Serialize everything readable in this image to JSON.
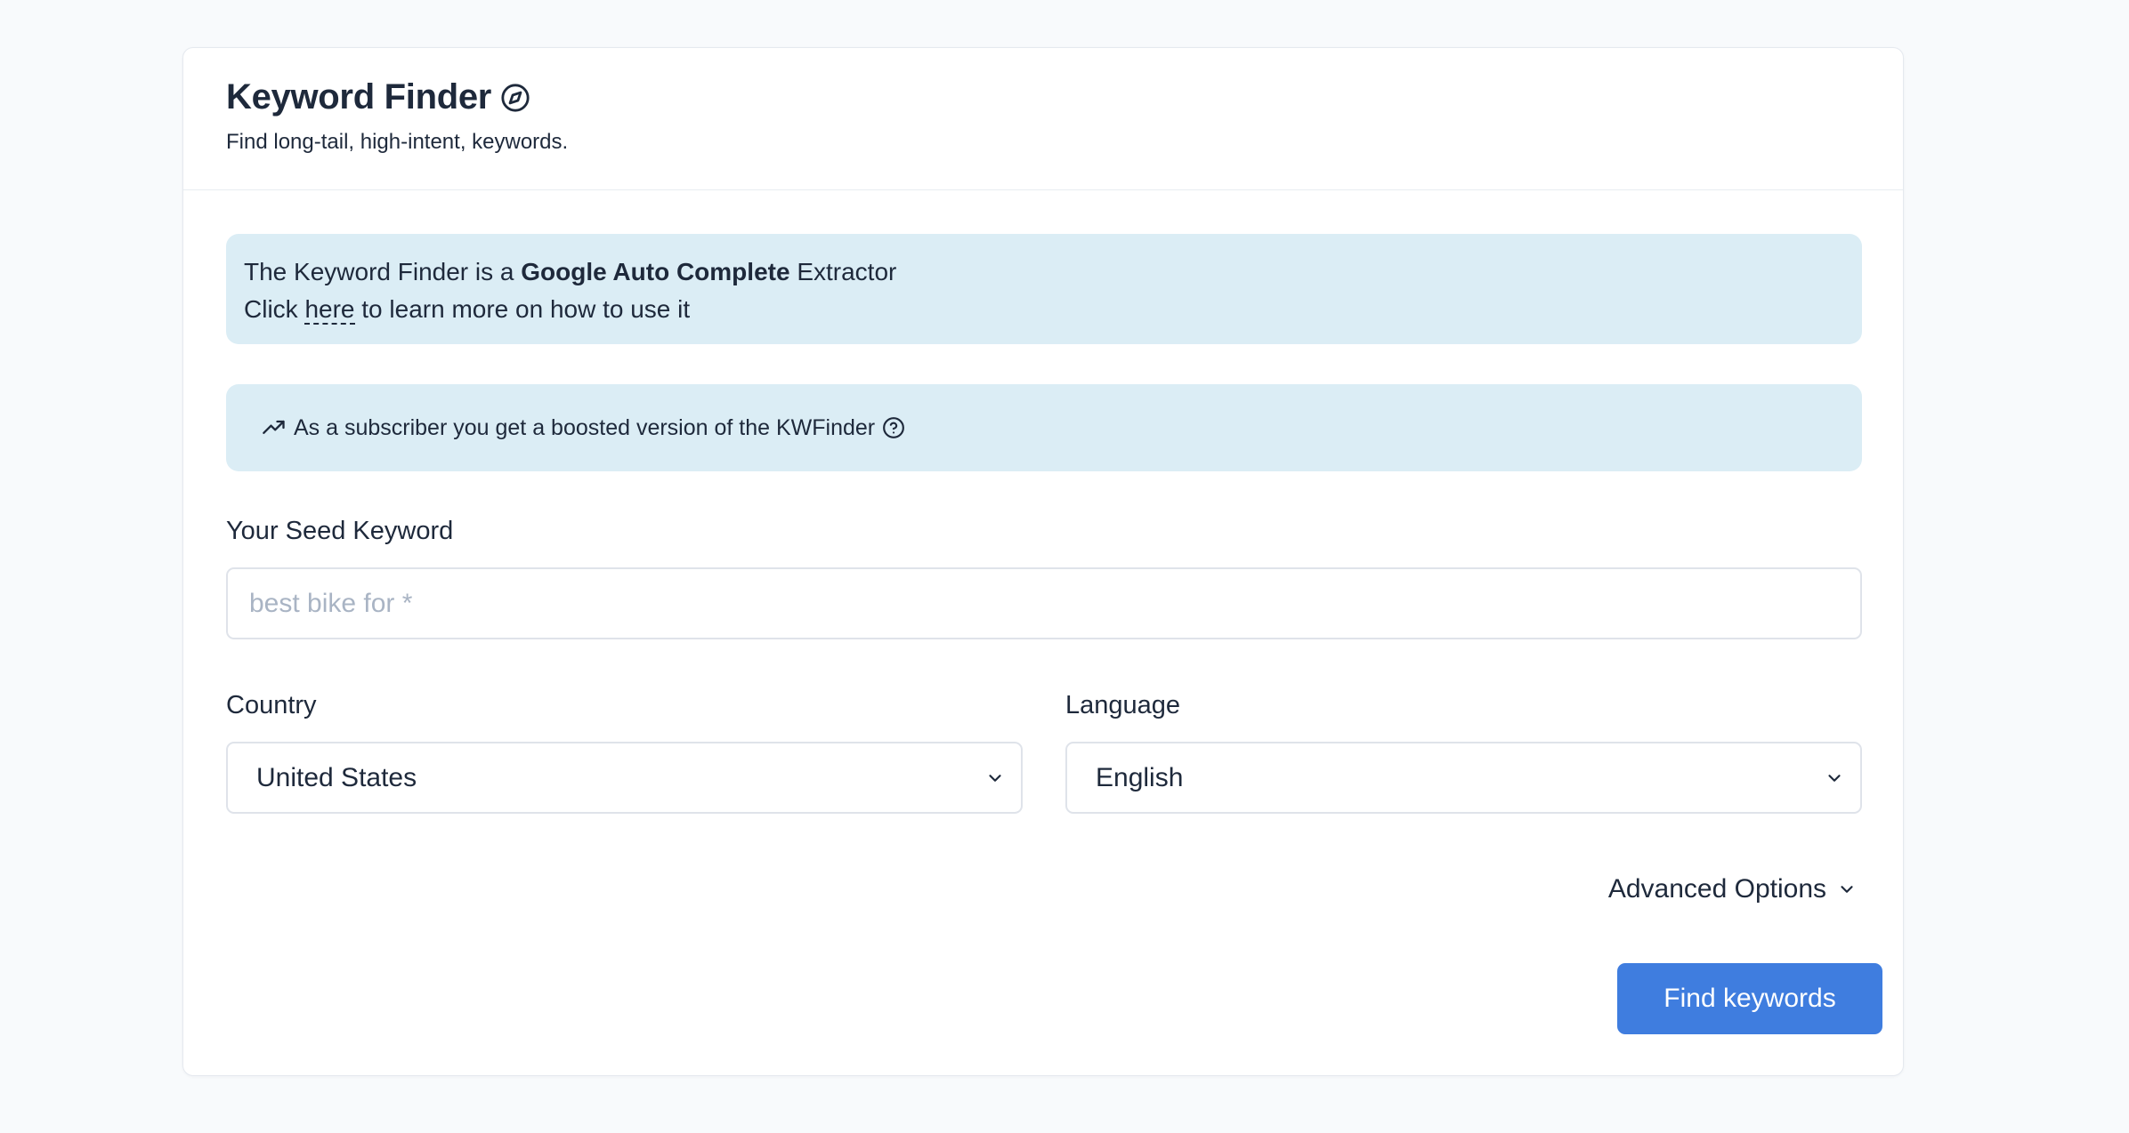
{
  "header": {
    "title": "Keyword Finder",
    "title_icon": "compass-icon",
    "subtitle": "Find long-tail, high-intent, keywords."
  },
  "info_alert": {
    "line1_prefix": "The Keyword Finder is a ",
    "line1_bold": "Google Auto Complete",
    "line1_suffix": " Extractor",
    "line2_prefix": "Click ",
    "line2_link": "here",
    "line2_suffix": " to learn more on how to use it"
  },
  "subscriber_alert": {
    "icon": "trending-up-icon",
    "text": "As a subscriber you get a boosted version of the KWFinder",
    "help_icon": "question-circle-icon"
  },
  "seed_keyword": {
    "label": "Your Seed Keyword",
    "value": "",
    "placeholder": "best bike for *"
  },
  "country": {
    "label": "Country",
    "selected": "United States"
  },
  "language": {
    "label": "Language",
    "selected": "English"
  },
  "advanced_options": {
    "label": "Advanced Options"
  },
  "submit": {
    "label": "Find keywords"
  },
  "colors": {
    "background": "#f8fafc",
    "card": "#ffffff",
    "alert": "#dbedf5",
    "text": "#1e293b",
    "placeholder": "#a9b4c4",
    "primary_button": "#3f7ddf"
  }
}
